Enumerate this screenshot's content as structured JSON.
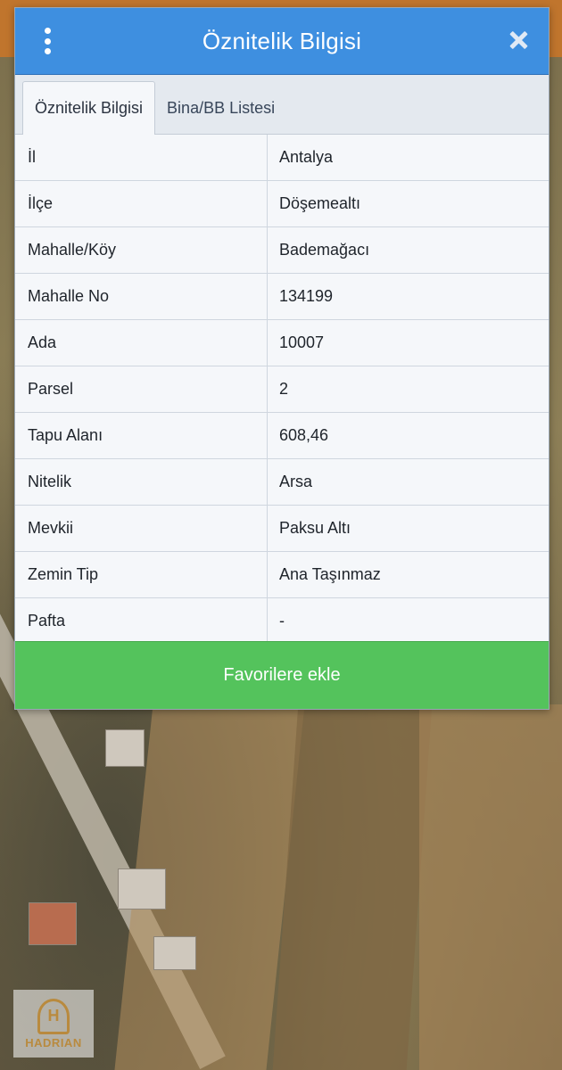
{
  "header": {
    "title": "Öznitelik Bilgisi"
  },
  "tabs": [
    {
      "label": "Öznitelik Bilgisi"
    },
    {
      "label": "Bina/BB Listesi"
    }
  ],
  "rows": [
    {
      "key": "İl",
      "value": "Antalya"
    },
    {
      "key": "İlçe",
      "value": "Döşemealtı"
    },
    {
      "key": "Mahalle/Köy",
      "value": "Bademağacı"
    },
    {
      "key": "Mahalle No",
      "value": "134199"
    },
    {
      "key": "Ada",
      "value": "10007"
    },
    {
      "key": "Parsel",
      "value": "2"
    },
    {
      "key": "Tapu Alanı",
      "value": "608,46"
    },
    {
      "key": "Nitelik",
      "value": "Arsa"
    },
    {
      "key": "Mevkii",
      "value": "Paksu Altı"
    },
    {
      "key": "Zemin Tip",
      "value": "Ana Taşınmaz"
    },
    {
      "key": "Pafta",
      "value": "-"
    }
  ],
  "footer": {
    "favorite_label": "Favorilere ekle"
  },
  "logo": {
    "text": "HADRIAN"
  }
}
